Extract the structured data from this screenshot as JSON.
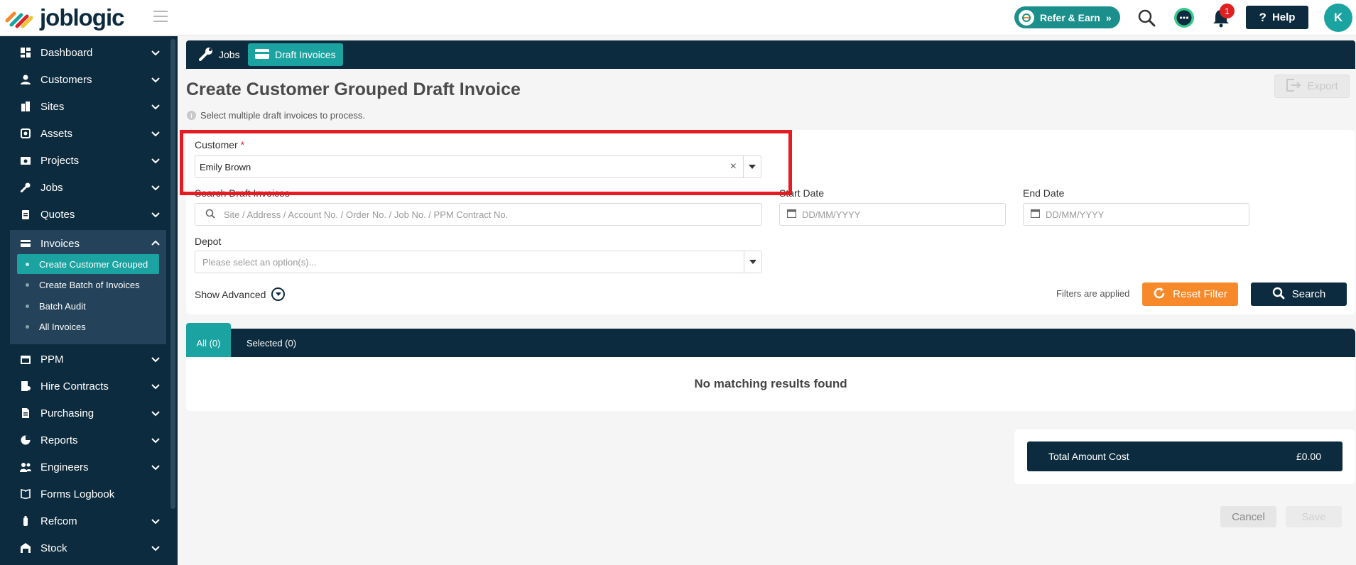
{
  "brand": {
    "name": "joblogic"
  },
  "topbar": {
    "refer_label": "Refer & Earn",
    "notification_count": "1",
    "help_label": "Help",
    "avatar_initial": "K"
  },
  "sidebar": {
    "items": [
      {
        "label": "Dashboard",
        "icon": "dashboard-icon"
      },
      {
        "label": "Customers",
        "icon": "person-icon"
      },
      {
        "label": "Sites",
        "icon": "building-icon"
      },
      {
        "label": "Assets",
        "icon": "asset-icon"
      },
      {
        "label": "Projects",
        "icon": "projects-icon"
      },
      {
        "label": "Jobs",
        "icon": "wrench-icon"
      },
      {
        "label": "Quotes",
        "icon": "clipboard-icon"
      },
      {
        "label": "Invoices",
        "icon": "card-icon"
      },
      {
        "label": "PPM",
        "icon": "calendar-icon"
      },
      {
        "label": "Hire Contracts",
        "icon": "hire-icon"
      },
      {
        "label": "Purchasing",
        "icon": "document-icon"
      },
      {
        "label": "Reports",
        "icon": "pie-chart-icon"
      },
      {
        "label": "Engineers",
        "icon": "people-icon"
      },
      {
        "label": "Forms Logbook",
        "icon": "book-icon"
      },
      {
        "label": "Refcom",
        "icon": "cylinder-icon"
      },
      {
        "label": "Stock",
        "icon": "warehouse-icon"
      }
    ],
    "invoice_subitems": [
      {
        "label": "Create Customer Grouped"
      },
      {
        "label": "Create Batch of Invoices"
      },
      {
        "label": "Batch Audit"
      },
      {
        "label": "All Invoices"
      }
    ]
  },
  "tabs": {
    "jobs": "Jobs",
    "draft_invoices": "Draft Invoices"
  },
  "page": {
    "title": "Create Customer Grouped Draft Invoice",
    "hint": "Select multiple draft invoices to process.",
    "export_label": "Export"
  },
  "filters": {
    "customer_label": "Customer",
    "required_mark": "*",
    "customer_value": "Emily Brown",
    "search_label": "Search Draft Invoices",
    "search_placeholder": "Site / Address / Account No. / Order No. / Job No. / PPM Contract No.",
    "start_label": "Start Date",
    "start_placeholder": "DD/MM/YYYY",
    "end_label": "End Date",
    "end_placeholder": "DD/MM/YYYY",
    "depot_label": "Depot",
    "depot_placeholder": "Please select an option(s)...",
    "show_advanced": "Show Advanced",
    "applied_text": "Filters are applied",
    "reset_label": "Reset Filter",
    "search_button": "Search"
  },
  "results": {
    "tab_all": "All (0)",
    "tab_selected": "Selected (0)",
    "empty_text": "No matching results found"
  },
  "totals": {
    "label": "Total Amount Cost",
    "value": "£0.00"
  },
  "actions": {
    "cancel": "Cancel",
    "save": "Save"
  },
  "colors": {
    "navy": "#0d2b3e",
    "teal": "#1aa3a0",
    "orange": "#f7892b",
    "highlight": "#e41b23"
  }
}
